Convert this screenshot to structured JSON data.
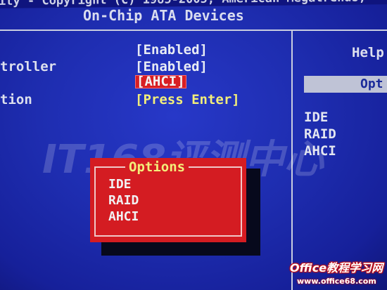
{
  "header": {
    "copyright": "ity - Copyright (C) 1985-2005, American Megatrends,",
    "title": "On-Chip ATA Devices"
  },
  "settings": {
    "rows": [
      {
        "label": "",
        "value": "[Enabled]"
      },
      {
        "label": "troller",
        "value": "[Enabled]"
      },
      {
        "label": "",
        "value": "[AHCI]"
      },
      {
        "label": "tion",
        "value": "[Press Enter]"
      }
    ]
  },
  "help": {
    "title": "Help",
    "tab_label": "Opt",
    "items": [
      "IDE",
      "RAID",
      "AHCI"
    ]
  },
  "popup": {
    "title": "Options",
    "options": [
      "IDE",
      "RAID",
      "AHCI"
    ]
  },
  "watermark": {
    "logo_text": "IT168评测中心",
    "site_name": "Office教程学习网",
    "site_url": "www.office68.com"
  },
  "colors": {
    "background": "#1e2db0",
    "divider": "#c9cde0",
    "value_text": "#e8ecf4",
    "highlight_text": "#f3ee7a",
    "selection_red": "#d81f24",
    "popup_red": "#d41c22",
    "help_tab": "#bfc3d6"
  }
}
